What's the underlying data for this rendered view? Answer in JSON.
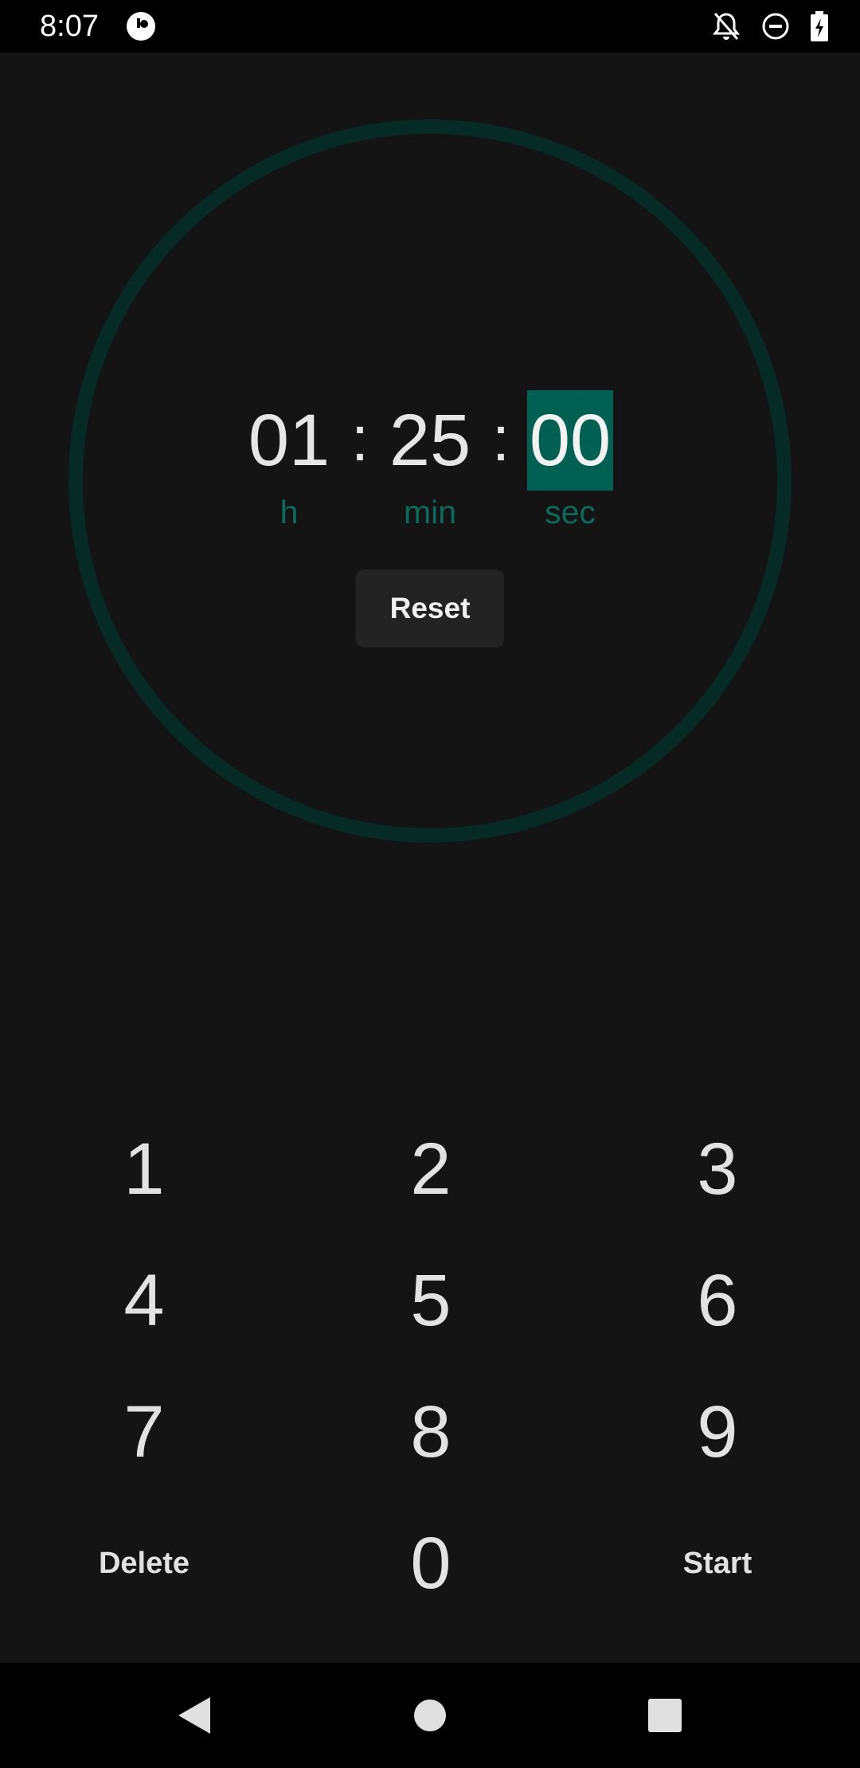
{
  "status_bar": {
    "time": "8:07",
    "left_icon": "app-notification-icon",
    "right_icons": [
      "notifications-off-icon",
      "do-not-disturb-icon",
      "battery-charging-icon"
    ]
  },
  "timer": {
    "hours": "01",
    "minutes": "25",
    "seconds": "00",
    "separator": ":",
    "unit_hours": "h",
    "unit_minutes": "min",
    "unit_seconds": "sec",
    "selected_field": "seconds",
    "reset_label": "Reset"
  },
  "keypad": {
    "keys": [
      "1",
      "2",
      "3",
      "4",
      "5",
      "6",
      "7",
      "8",
      "9"
    ],
    "zero": "0",
    "delete_label": "Delete",
    "start_label": "Start"
  },
  "nav_bar": {
    "buttons": [
      "back-icon",
      "home-icon",
      "recents-icon"
    ]
  },
  "colors": {
    "background": "#141414",
    "accent": "#006152",
    "ring": "#062a24",
    "unit_text": "#0b6a5a",
    "button_bg": "#232323"
  }
}
